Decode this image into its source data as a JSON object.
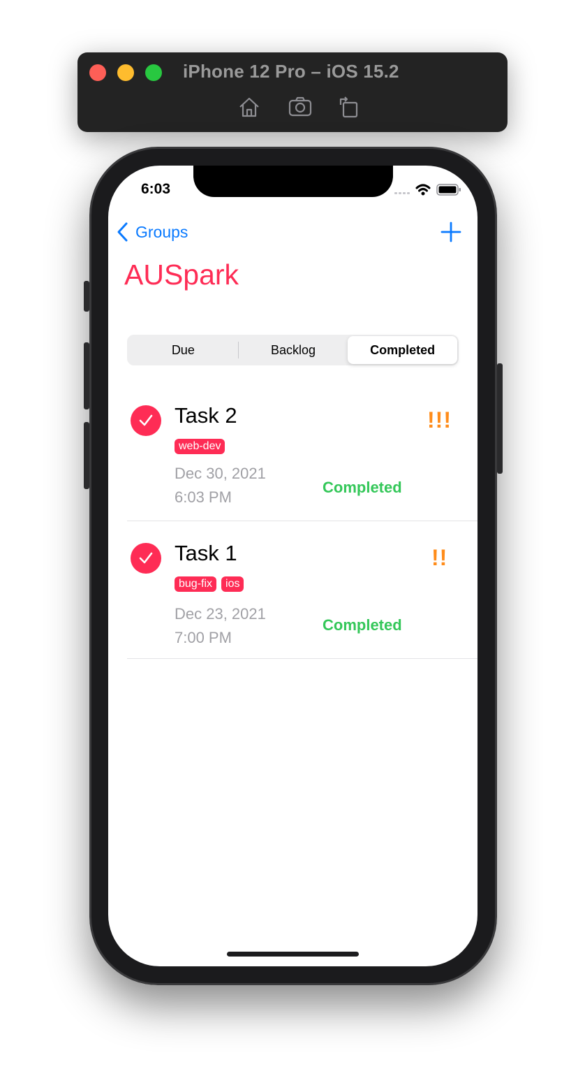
{
  "simulator": {
    "title": "iPhone 12 Pro – iOS 15.2",
    "toolbar_icons": [
      "home-icon",
      "camera-icon",
      "rotate-icon"
    ]
  },
  "status_bar": {
    "time": "6:03"
  },
  "nav": {
    "back_label": "Groups",
    "title": "AUSpark"
  },
  "segments": {
    "items": [
      "Due",
      "Backlog",
      "Completed"
    ],
    "selected": "Completed"
  },
  "tasks": [
    {
      "title": "Task 2",
      "tags": [
        "web-dev"
      ],
      "date": "Dec 30, 2021",
      "time": "6:03 PM",
      "status": "Completed",
      "priority": "!!!"
    },
    {
      "title": "Task 1",
      "tags": [
        "bug-fix",
        "ios"
      ],
      "date": "Dec 23, 2021",
      "time": "7:00 PM",
      "status": "Completed",
      "priority": "!!"
    }
  ],
  "colors": {
    "accent": "#fe2c55",
    "link": "#0a7aff",
    "completed": "#34c759",
    "priority": "#ff8c1a"
  }
}
